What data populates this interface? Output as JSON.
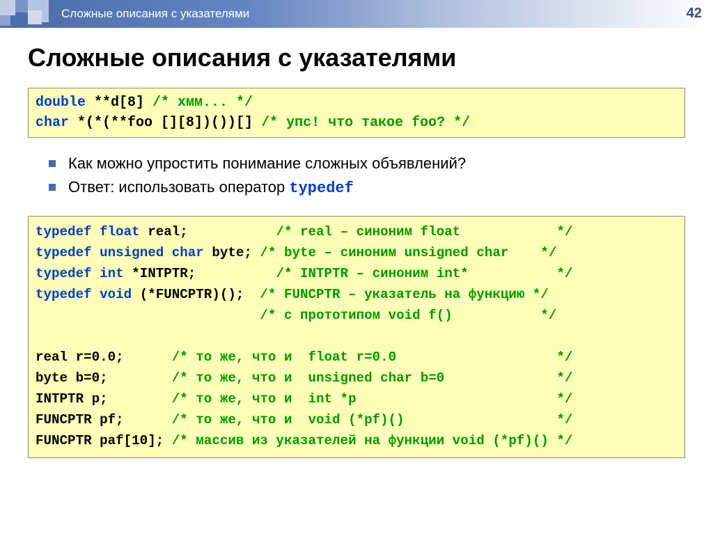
{
  "header": {
    "breadcrumb": "Сложные описания с указателями",
    "page_number": "42"
  },
  "title": "Сложные описания с указателями",
  "code1": {
    "l1": {
      "a": "double",
      "b": " **d[8] ",
      "c": "/* хмм... */"
    },
    "l2": {
      "a": "char",
      "b": " *(*(**foo [][8])())[] ",
      "c": "/* упс! что такое foo? */"
    }
  },
  "bullets": {
    "b1": "Как можно упростить понимание сложных объявлений?",
    "b2_pre": "Ответ: использовать оператор ",
    "b2_code": "typedef"
  },
  "code2": {
    "l1": {
      "kw": "typedef ",
      "ty": "float ",
      "id": "real;           ",
      "cm": "/* real – синоним float            */"
    },
    "l2": {
      "kw": "typedef ",
      "ty": "unsigned char ",
      "id": "byte; ",
      "cm": "/* byte – синоним unsigned char    */"
    },
    "l3": {
      "kw": "typedef ",
      "ty": "int ",
      "id": "*INTPTR;          ",
      "cm": "/* INTPTR – синоним int*           */"
    },
    "l4": {
      "kw": "typedef ",
      "ty": "void ",
      "id": "(*FUNCPTR)();  ",
      "cm": "/* FUNCPTR – указатель на функцию */"
    },
    "l5": {
      "sp": "                            ",
      "cm": "/* с прототипом void f()           */"
    },
    "blank": " ",
    "l6": {
      "id": "real r=0.0;      ",
      "cm": "/* то же, что и  float r=0.0                    */"
    },
    "l7": {
      "id": "byte b=0;        ",
      "cm": "/* то же, что и  unsigned char b=0              */"
    },
    "l8": {
      "id": "INTPTR p;        ",
      "cm": "/* то же, что и  int *p                         */"
    },
    "l9": {
      "id": "FUNCPTR pf;      ",
      "cm": "/* то же, что и  void (*pf)()                   */"
    },
    "l10": {
      "id": "FUNCPTR paf[10]; ",
      "cm": "/* массив из указателей на функции void (*pf)() */"
    }
  }
}
